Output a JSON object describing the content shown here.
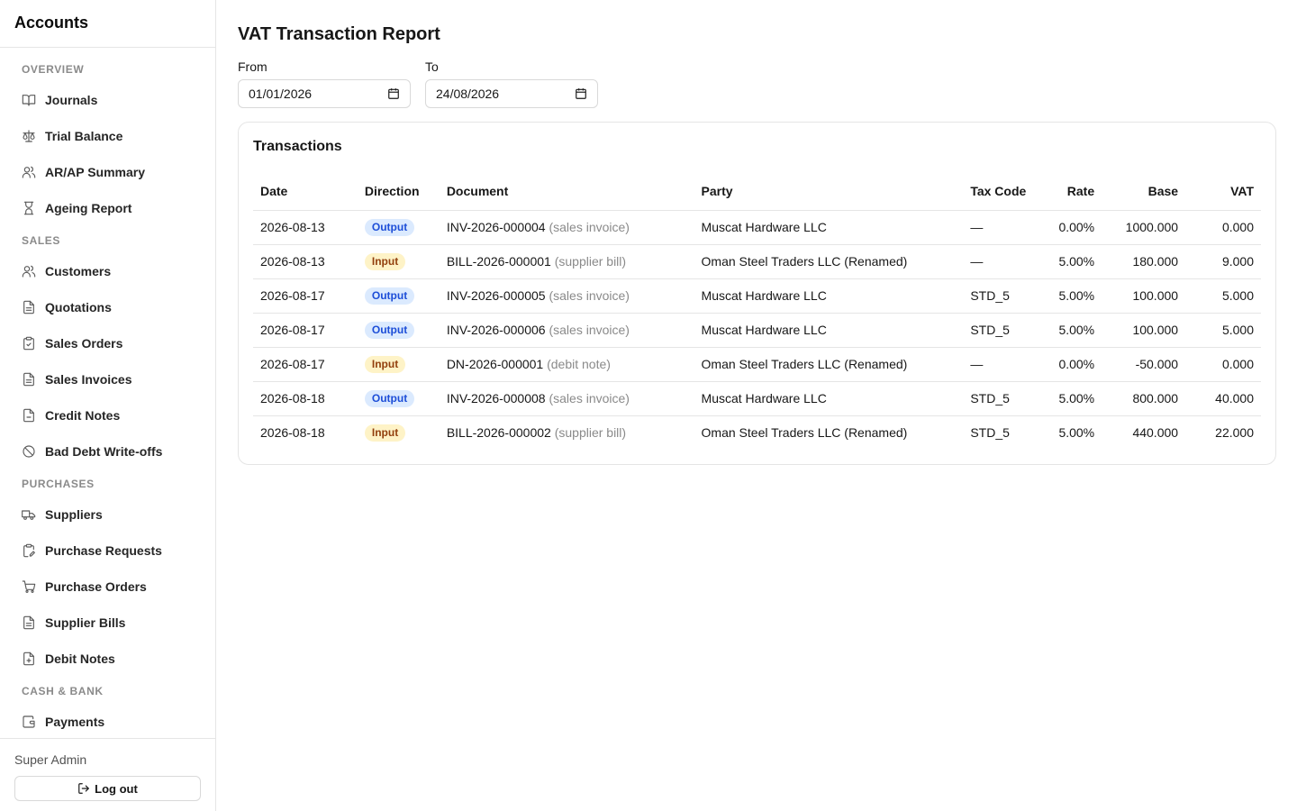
{
  "sidebar": {
    "brand": "Accounts",
    "sections": [
      {
        "title": "OVERVIEW",
        "items": [
          {
            "label": "Journals",
            "icon": "book-open-icon"
          },
          {
            "label": "Trial Balance",
            "icon": "scale-icon"
          },
          {
            "label": "AR/AP Summary",
            "icon": "users-icon"
          },
          {
            "label": "Ageing Report",
            "icon": "hourglass-icon"
          }
        ]
      },
      {
        "title": "SALES",
        "items": [
          {
            "label": "Customers",
            "icon": "users-icon"
          },
          {
            "label": "Quotations",
            "icon": "file-text-icon"
          },
          {
            "label": "Sales Orders",
            "icon": "clipboard-check-icon"
          },
          {
            "label": "Sales Invoices",
            "icon": "file-text-icon"
          },
          {
            "label": "Credit Notes",
            "icon": "file-minus-icon"
          },
          {
            "label": "Bad Debt Write-offs",
            "icon": "ban-icon"
          }
        ]
      },
      {
        "title": "PURCHASES",
        "items": [
          {
            "label": "Suppliers",
            "icon": "truck-icon"
          },
          {
            "label": "Purchase Requests",
            "icon": "clipboard-edit-icon"
          },
          {
            "label": "Purchase Orders",
            "icon": "cart-icon"
          },
          {
            "label": "Supplier Bills",
            "icon": "file-text-icon"
          },
          {
            "label": "Debit Notes",
            "icon": "file-plus-icon"
          }
        ]
      },
      {
        "title": "CASH & BANK",
        "items": [
          {
            "label": "Payments",
            "icon": "wallet-icon"
          }
        ]
      }
    ],
    "user_name": "Super Admin",
    "logout_label": "Log out"
  },
  "page": {
    "title": "VAT Transaction Report",
    "from_label": "From",
    "from_value": "01/01/2026",
    "to_label": "To",
    "to_value": "24/08/2026"
  },
  "transactions": {
    "title": "Transactions",
    "columns": [
      "Date",
      "Direction",
      "Document",
      "Party",
      "Tax Code",
      "Rate",
      "Base",
      "VAT"
    ],
    "rows": [
      {
        "date": "2026-08-13",
        "direction": "Output",
        "doc": "INV-2026-000004",
        "kind": "(sales invoice)",
        "party": "Muscat Hardware LLC",
        "tax_code": "—",
        "rate": "0.00%",
        "base": "1000.000",
        "vat": "0.000"
      },
      {
        "date": "2026-08-13",
        "direction": "Input",
        "doc": "BILL-2026-000001",
        "kind": "(supplier bill)",
        "party": "Oman Steel Traders LLC (Renamed)",
        "tax_code": "—",
        "rate": "5.00%",
        "base": "180.000",
        "vat": "9.000"
      },
      {
        "date": "2026-08-17",
        "direction": "Output",
        "doc": "INV-2026-000005",
        "kind": "(sales invoice)",
        "party": "Muscat Hardware LLC",
        "tax_code": "STD_5",
        "rate": "5.00%",
        "base": "100.000",
        "vat": "5.000"
      },
      {
        "date": "2026-08-17",
        "direction": "Output",
        "doc": "INV-2026-000006",
        "kind": "(sales invoice)",
        "party": "Muscat Hardware LLC",
        "tax_code": "STD_5",
        "rate": "5.00%",
        "base": "100.000",
        "vat": "5.000"
      },
      {
        "date": "2026-08-17",
        "direction": "Input",
        "doc": "DN-2026-000001",
        "kind": "(debit note)",
        "party": "Oman Steel Traders LLC (Renamed)",
        "tax_code": "—",
        "rate": "0.00%",
        "base": "-50.000",
        "vat": "0.000"
      },
      {
        "date": "2026-08-18",
        "direction": "Output",
        "doc": "INV-2026-000008",
        "kind": "(sales invoice)",
        "party": "Muscat Hardware LLC",
        "tax_code": "STD_5",
        "rate": "5.00%",
        "base": "800.000",
        "vat": "40.000"
      },
      {
        "date": "2026-08-18",
        "direction": "Input",
        "doc": "BILL-2026-000002",
        "kind": "(supplier bill)",
        "party": "Oman Steel Traders LLC (Renamed)",
        "tax_code": "STD_5",
        "rate": "5.00%",
        "base": "440.000",
        "vat": "22.000"
      }
    ]
  }
}
